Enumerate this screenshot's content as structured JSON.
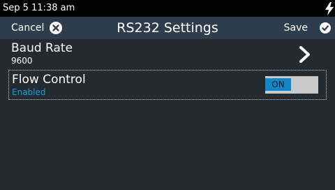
{
  "status_bar": {
    "time": "Sep 5 11:38 am",
    "icon": "lightning-bolt-icon"
  },
  "header": {
    "cancel_label": "Cancel",
    "cancel_icon": "close-circle-icon",
    "title": "RS232 Settings",
    "save_label": "Save",
    "save_icon": "check-circle-icon"
  },
  "settings": [
    {
      "title": "Baud Rate",
      "value": "9600",
      "control": "chevron-right-icon"
    },
    {
      "title": "Flow Control",
      "value": "Enabled",
      "control": "toggle",
      "toggle_label": "ON",
      "toggle_state": true
    }
  ],
  "colors": {
    "background": "#232b31",
    "header": "#2e3d4c",
    "status_bar": "#000000",
    "accent": "#1e9fe0",
    "toggle_on": "#1287c6",
    "toggle_track": "#c9c9c9"
  }
}
